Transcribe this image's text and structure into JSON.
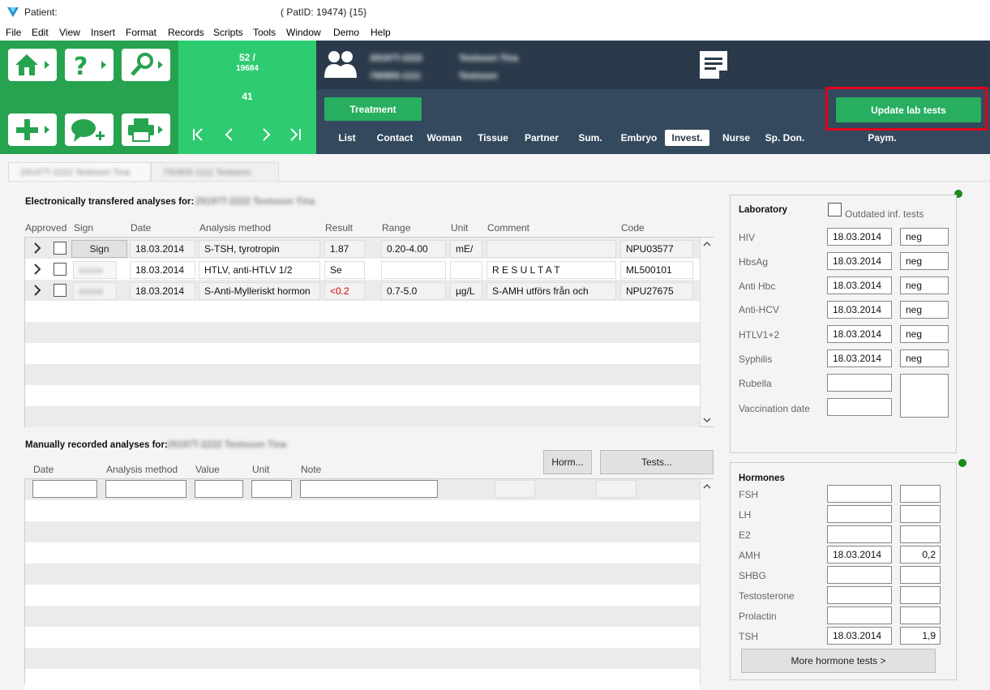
{
  "window": {
    "title": "Patient:",
    "patid": "( PatID: 19474) {15}"
  },
  "menu": [
    "File",
    "Edit",
    "View",
    "Insert",
    "Format",
    "Records",
    "Scripts",
    "Tools",
    "Window",
    "Demo",
    "Help"
  ],
  "record_nav": {
    "index": "52 /",
    "total": "19684",
    "current": "41"
  },
  "patient": {
    "line1_a": "29197T-2222",
    "line1_b": "Testsson Tina",
    "line2_a": "790905-1111",
    "line2_b": "Testsson"
  },
  "buttons": {
    "treatment": "Treatment",
    "update_lab": "Update lab tests",
    "sign": "Sign",
    "horm": "Horm...",
    "tests": "Tests...",
    "more_hormones": "More hormone tests >"
  },
  "nav_tabs": [
    "List",
    "Contact",
    "Woman",
    "Tissue",
    "Partner",
    "Sum.",
    "Embryo",
    "Invest.",
    "Nurse",
    "Sp. Don.",
    "Paym."
  ],
  "active_tab": "Invest.",
  "doc_tabs": [
    "29197T-2222 Testsson Tina",
    "790905-1111 Testsson"
  ],
  "electronic": {
    "title": "Electronically transfered analyses for:",
    "title_name": "29197T-2222 Testsson Tina",
    "headers": [
      "Approved",
      "Sign",
      "Date",
      "Analysis method",
      "Result",
      "Range",
      "Unit",
      "Comment",
      "Code"
    ],
    "rows": [
      {
        "sign": "Sign",
        "date": "18.03.2014",
        "method": "S-TSH, tyrotropin",
        "result": "1.87",
        "range": "0.20-4.00",
        "unit": "mE/",
        "comment": "",
        "code": "NPU03577"
      },
      {
        "sign": "blurred",
        "date": "18.03.2014",
        "method": "HTLV, anti-HTLV 1/2",
        "result": "Se",
        "range": "",
        "unit": "",
        "comment": "R E S U L T A T",
        "code": "ML500101"
      },
      {
        "sign": "blurred",
        "date": "18.03.2014",
        "method": "S-Anti-Mylleriskt hormon",
        "result": "<0.2",
        "range": "0.7-5.0",
        "unit": "µg/L",
        "comment": "S-AMH utförs från och",
        "code": "NPU27675"
      }
    ],
    "result_alert_color": "#d40000"
  },
  "manual": {
    "title": "Manually recorded analyses for:",
    "title_name": "29197T-2222 Testsson Tina",
    "headers": [
      "Date",
      "Analysis method",
      "Value",
      "Unit",
      "Note"
    ]
  },
  "laboratory": {
    "title": "Laboratory",
    "outdated_label": "Outdated inf. tests",
    "rows": [
      {
        "label": "HIV",
        "date": "18.03.2014",
        "value": "neg"
      },
      {
        "label": "HbsAg",
        "date": "18.03.2014",
        "value": "neg"
      },
      {
        "label": "Anti Hbc",
        "date": "18.03.2014",
        "value": "neg"
      },
      {
        "label": "Anti-HCV",
        "date": "18.03.2014",
        "value": "neg"
      },
      {
        "label": "HTLV1+2",
        "date": "18.03.2014",
        "value": "neg"
      },
      {
        "label": "Syphilis",
        "date": "18.03.2014",
        "value": "neg"
      },
      {
        "label": "Rubella",
        "date": "",
        "value": ""
      },
      {
        "label": "Vaccination date",
        "date": "",
        "value": ""
      }
    ]
  },
  "hormones": {
    "title": "Hormones",
    "rows": [
      {
        "label": "FSH",
        "date": "",
        "value": ""
      },
      {
        "label": "LH",
        "date": "",
        "value": ""
      },
      {
        "label": "E2",
        "date": "",
        "value": ""
      },
      {
        "label": "AMH",
        "date": "18.03.2014",
        "value": "0,2"
      },
      {
        "label": "SHBG",
        "date": "",
        "value": ""
      },
      {
        "label": "Testosterone",
        "date": "",
        "value": ""
      },
      {
        "label": "Prolactin",
        "date": "",
        "value": ""
      },
      {
        "label": "TSH",
        "date": "18.03.2014",
        "value": "1,9"
      }
    ]
  },
  "colors": {
    "green_dark": "#27a34f",
    "green_light": "#2ecc71",
    "header_dark": "#2b3a4a",
    "tabbar": "#35495e",
    "highlight_red": "#e0001b",
    "status_dot": "#1a8a1a"
  }
}
